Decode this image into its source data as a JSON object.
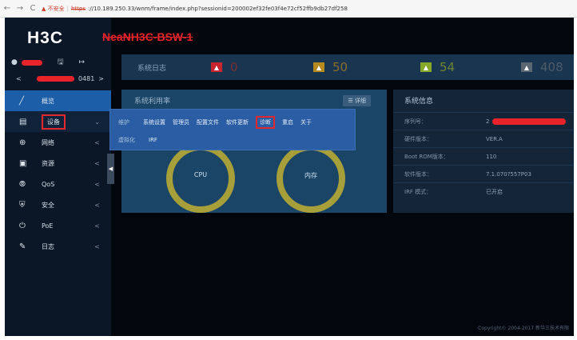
{
  "browser": {
    "back": "←",
    "forward": "→",
    "reload": "C",
    "security": "▲ 不安全",
    "scheme": "https",
    "url": "://10.189.250.33/wnm/frame/index.php?sessionid=200002ef32fe03f4e72cf52ffb9db27df258"
  },
  "app": {
    "logo": "H3C",
    "hostname": "NeaNH3C-BSW-1",
    "device_suffix": "0481",
    "sidebar": {
      "items": [
        {
          "label": "概览",
          "icon": "overview-icon"
        },
        {
          "label": "设备",
          "icon": "device-icon"
        },
        {
          "label": "网络",
          "icon": "network-icon"
        },
        {
          "label": "资源",
          "icon": "resource-icon"
        },
        {
          "label": "QoS",
          "icon": "qos-icon"
        },
        {
          "label": "安全",
          "icon": "security-icon"
        },
        {
          "label": "PoE",
          "icon": "poe-icon"
        },
        {
          "label": "日志",
          "icon": "log-icon"
        }
      ]
    },
    "log_band": {
      "title": "系统日志",
      "counts": [
        {
          "value": "0",
          "color": "#c8262e"
        },
        {
          "value": "50",
          "color": "#b78a1e"
        },
        {
          "value": "54",
          "color": "#86a92c"
        },
        {
          "value": "408",
          "color": "#5a6672"
        }
      ]
    },
    "cpu_panel": {
      "title": "系统利用率",
      "details": "详细",
      "gauges": [
        "CPU",
        "内存"
      ]
    },
    "dropdown": {
      "row1": [
        "维护",
        "系统设置",
        "管理员",
        "配置文件",
        "软件更新",
        "诊断",
        "重启",
        "关于"
      ],
      "row2": [
        "虚拟化",
        "IRF"
      ]
    },
    "sys_info": {
      "title": "系统信息",
      "rows": [
        {
          "key": "序列号：",
          "value": "2"
        },
        {
          "key": "硬件版本：",
          "value": "VER.A"
        },
        {
          "key": "Boot ROM版本：",
          "value": "110"
        },
        {
          "key": "软件版本：",
          "value": "7.1.070?557P03"
        },
        {
          "key": "IRF 模式：",
          "value": "已开启"
        }
      ]
    },
    "copyright": "Copyright© 2004-2017 新华三技术有限"
  }
}
